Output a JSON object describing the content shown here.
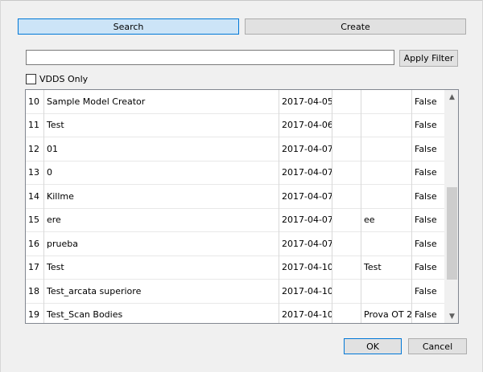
{
  "toolbar": {
    "search_label": "Search",
    "create_label": "Create"
  },
  "filter": {
    "value": "",
    "placeholder": "",
    "apply_label": "Apply Filter"
  },
  "vdds_only": {
    "label": "VDDS Only",
    "checked": false
  },
  "grid": {
    "rows": [
      {
        "num": "10",
        "name": "Sample Model Creator",
        "date": "2017-04-05",
        "blank": "",
        "extra": "",
        "flag": "False"
      },
      {
        "num": "11",
        "name": "Test",
        "date": "2017-04-06",
        "blank": "",
        "extra": "",
        "flag": "False"
      },
      {
        "num": "12",
        "name": "01",
        "date": "2017-04-07",
        "blank": "",
        "extra": "",
        "flag": "False"
      },
      {
        "num": "13",
        "name": "0",
        "date": "2017-04-07",
        "blank": "",
        "extra": "",
        "flag": "False"
      },
      {
        "num": "14",
        "name": "Killme",
        "date": "2017-04-07",
        "blank": "",
        "extra": "",
        "flag": "False"
      },
      {
        "num": "15",
        "name": "ere",
        "date": "2017-04-07",
        "blank": "",
        "extra": "ee",
        "flag": "False"
      },
      {
        "num": "16",
        "name": " prueba",
        "date": "2017-04-07",
        "blank": "",
        "extra": "",
        "flag": "False"
      },
      {
        "num": "17",
        "name": "Test",
        "date": "2017-04-10",
        "blank": "",
        "extra": "Test",
        "flag": "False"
      },
      {
        "num": "18",
        "name": "Test_arcata superiore",
        "date": "2017-04-10",
        "blank": "",
        "extra": "",
        "flag": "False"
      },
      {
        "num": "19",
        "name": "Test_Scan Bodies",
        "date": "2017-04-10",
        "blank": "",
        "extra": "Prova OT 2",
        "flag": "False"
      }
    ],
    "scroll_position": 0.55,
    "scroll_visible_fraction": 0.45
  },
  "footer": {
    "ok_label": "OK",
    "cancel_label": "Cancel"
  },
  "colors": {
    "accent": "#0078d7",
    "selected_button_bg": "#cce4f7"
  }
}
